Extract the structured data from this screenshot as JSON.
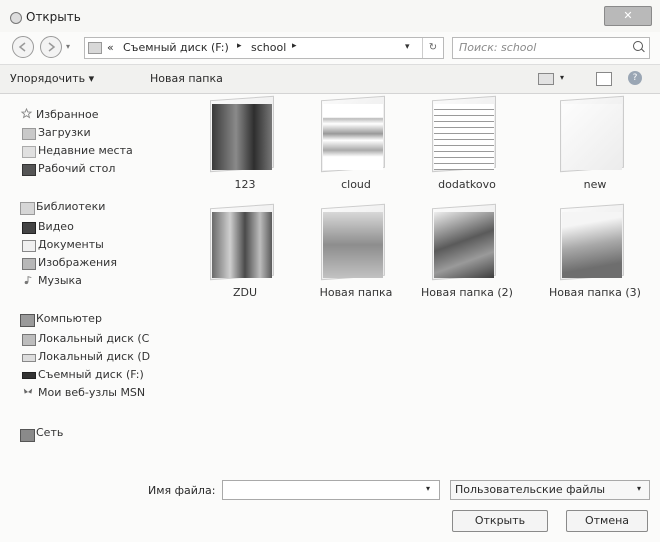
{
  "window": {
    "title": "Открыть",
    "close_symbol": "✕"
  },
  "nav": {
    "back_icon": "back-icon",
    "forward_icon": "forward-icon"
  },
  "address": {
    "chevrons": "«",
    "segments": [
      "Съемный диск (F:)",
      "school"
    ],
    "separator": "▸",
    "refresh_symbol": "↻"
  },
  "search": {
    "placeholder": "Поиск: school"
  },
  "toolbar": {
    "organize_label": "Упорядочить ▾",
    "new_folder_label": "Новая папка",
    "help_symbol": "?"
  },
  "sidebar": {
    "favorites": {
      "label": "Избранное",
      "items": [
        "Загрузки",
        "Недавние места",
        "Рабочий стол"
      ]
    },
    "libraries": {
      "label": "Библиотеки",
      "items": [
        "Видео",
        "Документы",
        "Изображения",
        "Музыка"
      ]
    },
    "computer": {
      "label": "Компьютер",
      "items": [
        "Локальный диск (C",
        "Локальный диск (D",
        "Съемный диск (F:)",
        "Мои веб-узлы MSN"
      ]
    },
    "network": {
      "label": "Сеть"
    }
  },
  "folders": [
    {
      "name": "123"
    },
    {
      "name": "cloud"
    },
    {
      "name": "dodatkovo"
    },
    {
      "name": "new"
    },
    {
      "name": "ZDU"
    },
    {
      "name": "Новая папка"
    },
    {
      "name": "Новая папка (2)"
    },
    {
      "name": "Новая папка (3)"
    }
  ],
  "bottom": {
    "filename_label": "Имя файла:",
    "filename_value": "",
    "filetype": "Пользовательские файлы",
    "open_label": "Открыть",
    "cancel_label": "Отмена"
  }
}
